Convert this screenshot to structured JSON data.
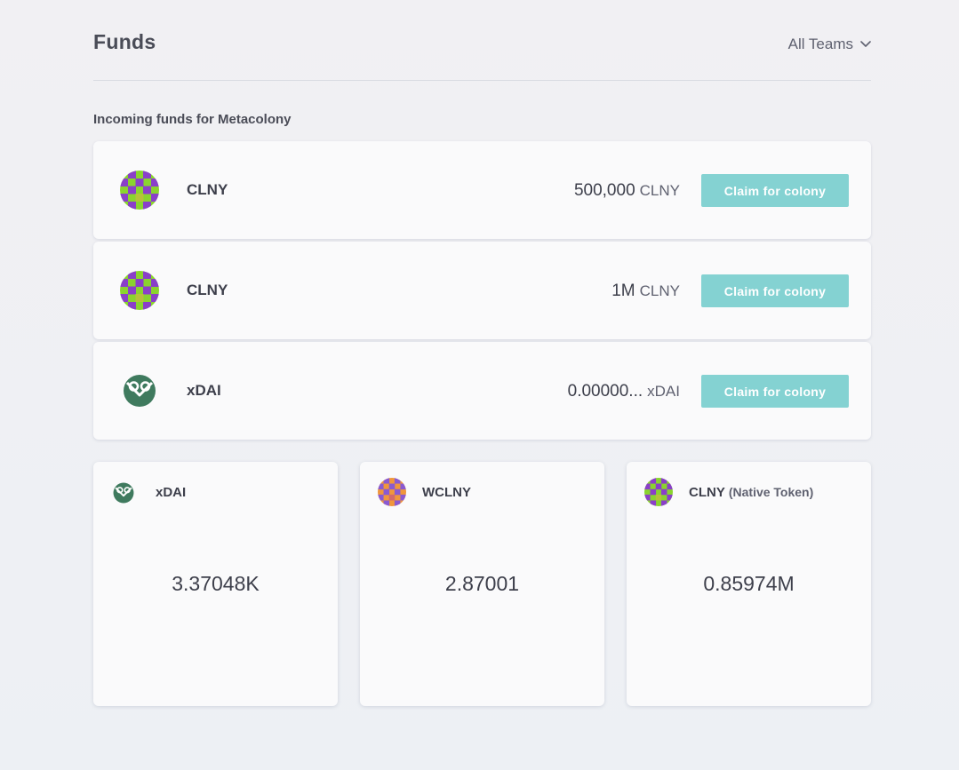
{
  "header": {
    "title": "Funds",
    "team_select": {
      "selected": "All Teams",
      "icon": "chevron-down-icon"
    }
  },
  "incoming": {
    "label": "Incoming funds for Metacolony",
    "rows": [
      {
        "token": "CLNY",
        "icon": "clny-token-icon",
        "amount": "500,000",
        "symbol": "CLNY",
        "action": "Claim for colony"
      },
      {
        "token": "CLNY",
        "icon": "clny-token-icon",
        "amount": "1M",
        "symbol": "CLNY",
        "action": "Claim for colony"
      },
      {
        "token": "xDAI",
        "icon": "xdai-token-icon",
        "amount": "0.00000...",
        "symbol": "xDAI",
        "action": "Claim for colony"
      }
    ]
  },
  "balances": [
    {
      "token": "xDAI",
      "icon": "xdai-token-icon",
      "value": "3.37048K"
    },
    {
      "token": "WCLNY",
      "icon": "wclny-token-icon",
      "value": "2.87001"
    },
    {
      "token": "CLNY",
      "native_label": "(Native Token)",
      "icon": "clny-token-icon",
      "value": "0.85974M"
    }
  ],
  "colors": {
    "claim_button": "#84d2d2",
    "clny_green": "#8ad42e",
    "clny_purple": "#8a3fc9",
    "wclny_orange": "#f0963c",
    "wclny_purple": "#8a5ad0",
    "xdai_green": "#3f7a5e"
  }
}
